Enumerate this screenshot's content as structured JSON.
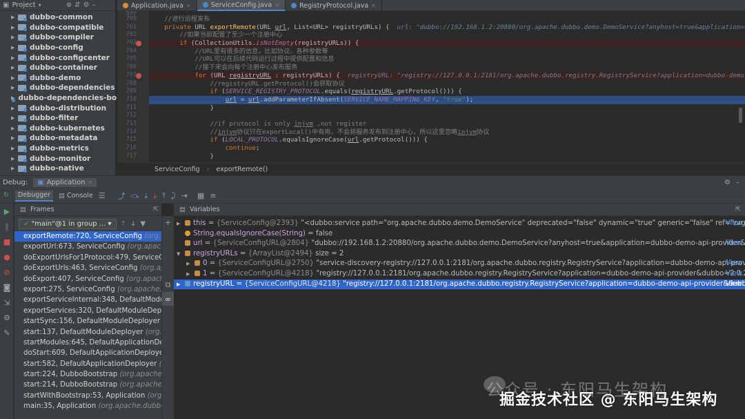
{
  "project": {
    "title": "Project",
    "modules": [
      "dubbo-common",
      "dubbo-compatible",
      "dubbo-compiler",
      "dubbo-config",
      "dubbo-configcenter",
      "dubbo-container",
      "dubbo-demo",
      "dubbo-dependencies",
      "dubbo-dependencies-bo",
      "dubbo-distribution",
      "dubbo-filter",
      "dubbo-kubernetes",
      "dubbo-metadata",
      "dubbo-metrics",
      "dubbo-monitor",
      "dubbo-native"
    ]
  },
  "editor_tabs": [
    "Application.java",
    "ServiceConfig.java",
    "RegistryProtocol.java"
  ],
  "line_numbers": [
    "699",
    "700",
    "701",
    "702",
    "703",
    "704",
    "705",
    "706",
    "707",
    "708",
    "709",
    "710",
    "711",
    "712",
    "713",
    "714",
    "715",
    "716",
    "717"
  ],
  "code": {
    "l700": "//进行远程发布",
    "l701a": "private",
    "l701b": " URL ",
    "l701c": "exportRemote",
    "l701d": "(URL ",
    "l701e": "url",
    "l701f": ", List<URL> registryURLs) {  ",
    "l701hint": "url: \"dubbo://192.168.1.2:20880/org.apache.dubbo.demo.DemoService?anyhost=true&application=dubbo",
    "l702": "//如果当前配置了至少一个注册中心",
    "l703a": "if",
    "l703b": " (CollectionUtils.",
    "l703c": "isNotEmpty",
    "l703d": "(registryURLs)) {",
    "l704": "//URL里有很多的信息，比如协议、各种参数等",
    "l705": "//URL可以在后续代码运行过程中提供配置和信息",
    "l706": "//接下来会向每个注册中心发布服务",
    "l707a": "for",
    "l707b": " (URL ",
    "l707c": "registryURL",
    "l707d": " : registryURLs) {  ",
    "l707hint": "registryURL: \"registry://127.0.0.1:2181/org.apache.dubbo.registry.RegistryService?application=dubbo-demo-ap",
    "l708": "//registryURL.getProtocol()会获取协议",
    "l709a": "if",
    "l709b": " (",
    "l709c": "SERVICE_REGISTRY_PROTOCOL",
    "l709d": ".equals(",
    "l709e": "registryURL",
    "l709f": ".getProtocol())) {",
    "l710a": "url",
    "l710b": " = ",
    "l710c": "url",
    "l710d": ".addParameterIfAbsent(",
    "l710e": "SERVICE_NAME_MAPPING_KEY",
    "l710f": ", ",
    "l710g": "\"true\"",
    "l710h": ");",
    "l711": "}",
    "l713a": "//if protocol is only ",
    "l713b": "injvm",
    "l713c": " ,not register",
    "l714a": "//",
    "l714b": "injvm",
    "l714c": "协议只在exportLocal()中有用，不会将服务发布到注册中心，所以这里忽略",
    "l714d": "injvm",
    "l714e": "协议",
    "l715a": "if",
    "l715b": " (",
    "l715c": "LOCAL_PROTOCOL",
    "l715d": ".equalsIgnoreCase(",
    "l715e": "url",
    "l715f": ".getProtocol())) {",
    "l716a": "continue",
    "l716b": ";",
    "l717": "}"
  },
  "breadcrumb": [
    "ServiceConfig",
    "exportRemote()"
  ],
  "debug": {
    "label": "Debug:",
    "config": "Application",
    "tabs": [
      "Debugger",
      "Console"
    ]
  },
  "frames": {
    "header": "Frames",
    "thread": "\"main\"@1 in group ...",
    "items": [
      {
        "m": "exportRemote:720, ServiceConfig",
        "p": "(org.apa"
      },
      {
        "m": "exportUrl:673, ServiceConfig",
        "p": "(org.apache"
      },
      {
        "m": "doExportUrlsFor1Protocol:479, ServiceCo",
        "p": ""
      },
      {
        "m": "doExportUrls:463, ServiceConfig",
        "p": "(org.apa"
      },
      {
        "m": "doExport:407, ServiceConfig",
        "p": "(org.apache"
      },
      {
        "m": "export:275, ServiceConfig",
        "p": "(org.apache.du"
      },
      {
        "m": "exportServiceInternal:348, DefaultModuleI",
        "p": ""
      },
      {
        "m": "exportServices:320, DefaultModuleDeploy",
        "p": ""
      },
      {
        "m": "startSync:156, DefaultModuleDeployer",
        "p": "(or"
      },
      {
        "m": "start:137, DefaultModuleDeployer",
        "p": "(org.apa"
      },
      {
        "m": "startModules:645, DefaultApplicationDepl",
        "p": ""
      },
      {
        "m": "doStart:609, DefaultApplicationDeployer",
        "p": "("
      },
      {
        "m": "start:582, DefaultApplicationDeployer",
        "p": "(o"
      },
      {
        "m": "start:224, DubboBootstrap",
        "p": "(org.apache.d"
      },
      {
        "m": "start:214, DubboBootstrap",
        "p": "(org.apache.d"
      },
      {
        "m": "startWithBootstrap:53, Application",
        "p": "(org.a"
      },
      {
        "m": "main:35, Application",
        "p": "(org.apache.dubbo.d"
      }
    ]
  },
  "variables": {
    "header": "Variables",
    "rows": [
      {
        "name": "this",
        "eq": " = ",
        "type": "{ServiceConfig@2393} ",
        "val": "\"<dubbo:service path=\"org.apache.dubbo.demo.DemoService\" deprecated=\"false\" dynamic=\"true\" generic=\"false\" ref=\"org.apach",
        "view": "View"
      },
      {
        "name": "String.equalsIgnoreCase(String)",
        "eq": " = ",
        "type": "",
        "val": "false",
        "view": ""
      },
      {
        "name": "url",
        "eq": " = ",
        "type": "{ServiceConfigURL@2804} ",
        "val": "\"dubbo://192.168.1.2:20880/org.apache.dubbo.demo.DemoService?anyhost=true&application=dubbo-demo-api-provider&back",
        "view": "View"
      },
      {
        "name": "registryURLs",
        "eq": " = ",
        "type": "{ArrayList@2494} ",
        "val": " size = 2",
        "view": ""
      },
      {
        "name": "0",
        "eq": " = ",
        "type": "{ServiceConfigURL@2750} ",
        "val": "\"service-discovery-registry://127.0.0.1:2181/org.apache.dubbo.registry.RegistryService?application=dubbo-demo-api-provider",
        "view": "View"
      },
      {
        "name": "1",
        "eq": " = ",
        "type": "{ServiceConfigURL@4218} ",
        "val": "\"registry://127.0.0.1:2181/org.apache.dubbo.registry.RegistryService?application=dubbo-demo-api-provider&dubbo=2.0.2&pid",
        "view": "View"
      },
      {
        "name": "registryURL",
        "eq": " = ",
        "type": "{ServiceConfigURL@4218} ",
        "val": "\"registry://127.0.0.1:2181/org.apache.dubbo.registry.RegistryService?application=dubbo-demo-api-provider&dubbo=2.",
        "view": "View"
      }
    ]
  },
  "watermark": {
    "line1": "公众号 · 东阳马生架构",
    "line2": "掘金技术社区 @ 东阳马生架构"
  }
}
